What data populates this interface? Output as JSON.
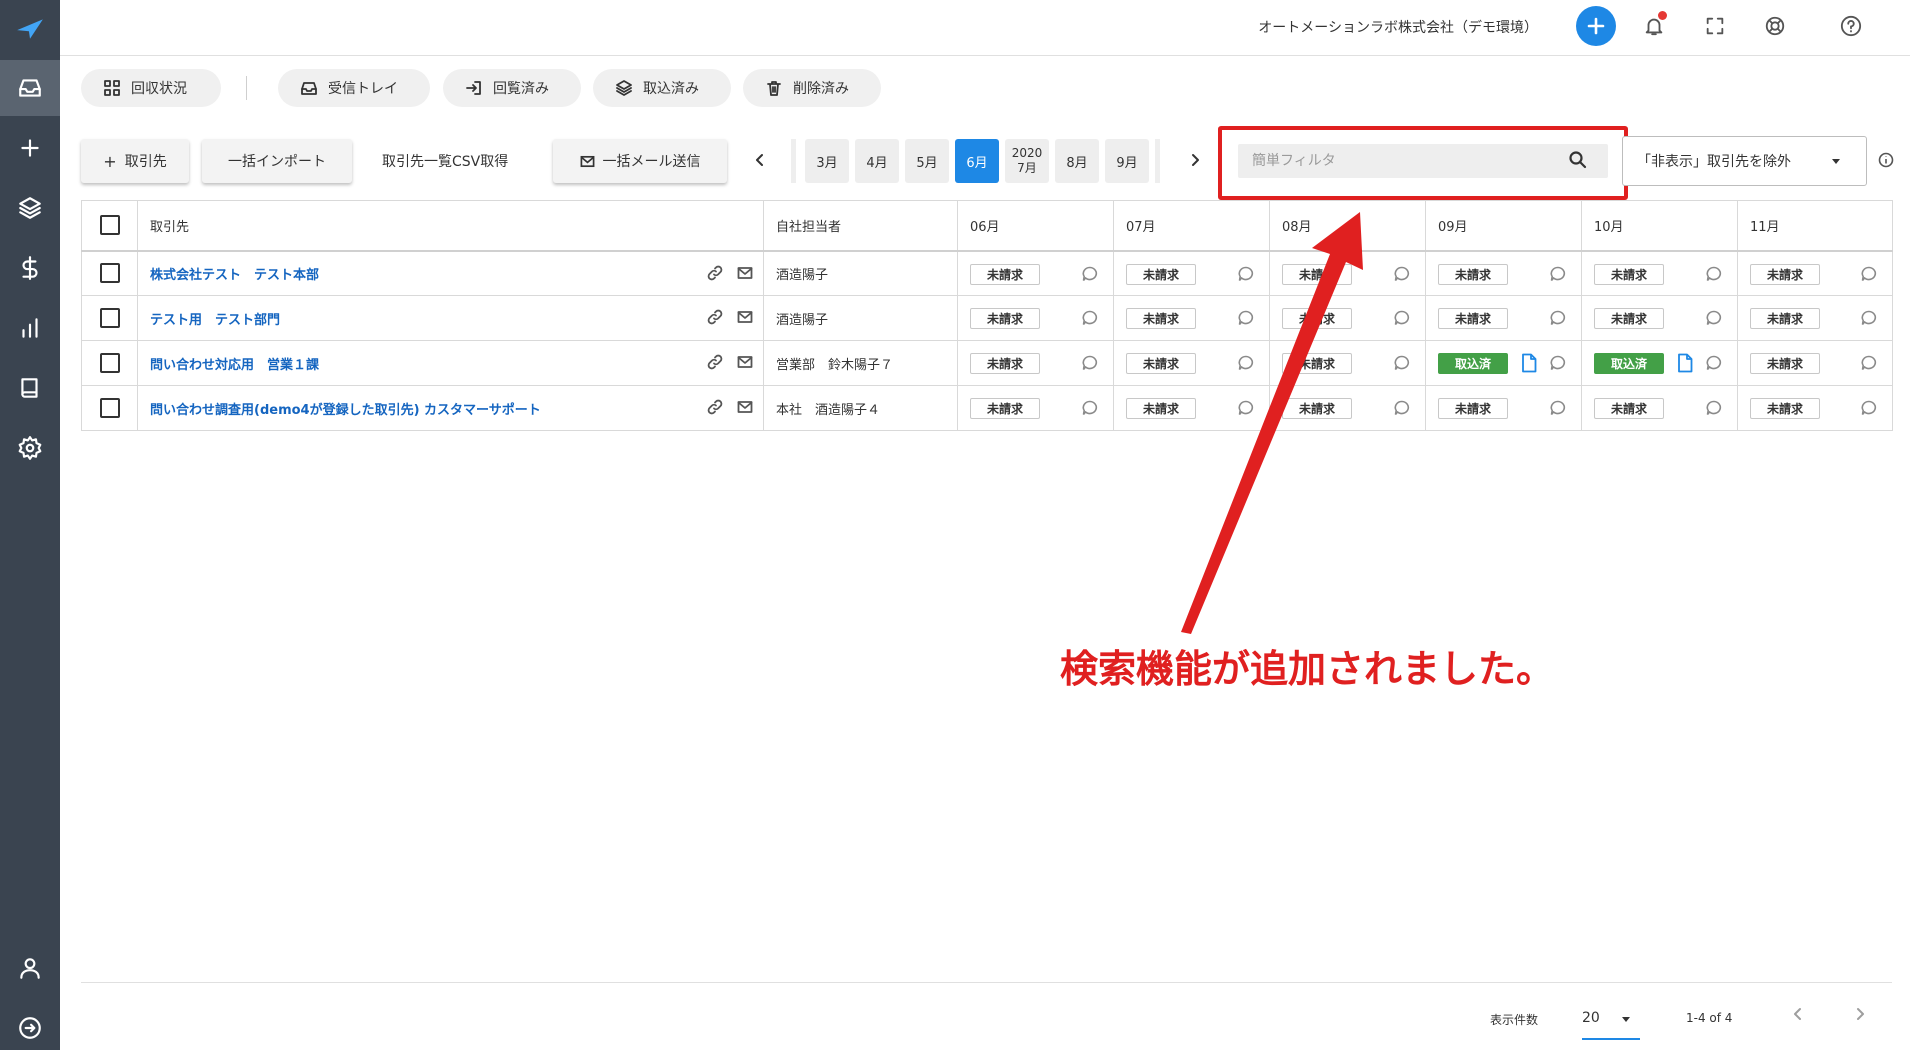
{
  "header": {
    "company": "オートメーションラボ株式会社（デモ環境）"
  },
  "tabs": [
    {
      "label": "回収状況",
      "icon": "grid-icon"
    },
    {
      "label": "受信トレイ",
      "icon": "inbox-icon"
    },
    {
      "label": "回覧済み",
      "icon": "login-icon"
    },
    {
      "label": "取込済み",
      "icon": "layers-icon"
    },
    {
      "label": "削除済み",
      "icon": "trash-icon"
    }
  ],
  "toolbar": {
    "add_client": "取引先",
    "bulk_import": "一括インポート",
    "csv": "取引先一覧CSV取得",
    "bulk_mail": "一括メール送信"
  },
  "months": [
    "3月",
    "4月",
    "5月",
    "6月",
    "2020",
    "7月",
    "8月",
    "9月"
  ],
  "active_month": "6月",
  "filter": {
    "placeholder": "簡単フィルタ",
    "select_value": "「非表示」取引先を除外"
  },
  "table": {
    "headers": [
      "取引先",
      "自社担当者",
      "06月",
      "07月",
      "08月",
      "09月",
      "10月",
      "11月"
    ],
    "rows": [
      {
        "client": "株式会社テスト　テスト本部",
        "staff": "酒造陽子",
        "statuses": [
          "未請求",
          "未請求",
          "未請求",
          "未請求",
          "未請求",
          "未請求"
        ]
      },
      {
        "client": "テスト用　テスト部門",
        "staff": "酒造陽子",
        "statuses": [
          "未請求",
          "未請求",
          "未請求",
          "未請求",
          "未請求",
          "未請求"
        ]
      },
      {
        "client": "問い合わせ対応用　営業１課",
        "staff": "営業部　鈴木陽子７",
        "statuses": [
          "未請求",
          "未請求",
          "未請求",
          "取込済",
          "取込済",
          "未請求"
        ]
      },
      {
        "client": "問い合わせ調査用(demo4が登録した取引先)  カスタマーサポート",
        "staff": "本社　酒造陽子４",
        "statuses": [
          "未請求",
          "未請求",
          "未請求",
          "未請求",
          "未請求",
          "未請求"
        ]
      }
    ]
  },
  "pagination": {
    "label": "表示件数",
    "size": "20",
    "range": "1-4 of 4"
  },
  "annotation": "検索機能が追加されました。",
  "colors": {
    "sidebar": "#3a4450",
    "accent": "#1e88e5",
    "link": "#1565c0",
    "done": "#43a047",
    "annotation": "#e02020"
  }
}
